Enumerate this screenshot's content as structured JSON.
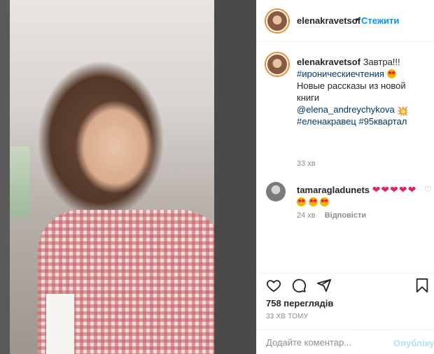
{
  "post": {
    "author": "elenakravetsof",
    "follow_label": "Стежити",
    "dot": "•"
  },
  "caption": {
    "username": "elenakravetsof",
    "line1": "Завтра!!!",
    "hashtag1": "#ироническиечтения",
    "line2": "Новые рассказы из новой книги",
    "mention": "@elena_andreychykova",
    "hashtag2": "#еленакравец",
    "hashtag3": "#95квартал",
    "time": "33 хв"
  },
  "reply": {
    "username": "tamaragladunets",
    "hearts": "❤❤❤❤❤",
    "time": "24 хв",
    "reply_label": "Відповісти"
  },
  "stats": {
    "views": "758 переглядів",
    "ago": "33 ХВ ТОМУ"
  },
  "comment": {
    "placeholder": "Додайте коментар...",
    "post_label": "Опублікувати"
  },
  "colors": {
    "accent": "#0095f6",
    "heart": "#e0245e",
    "muted": "#8e8e8e"
  },
  "icons": [
    "heart-icon",
    "comment-icon",
    "share-icon",
    "bookmark-icon"
  ]
}
